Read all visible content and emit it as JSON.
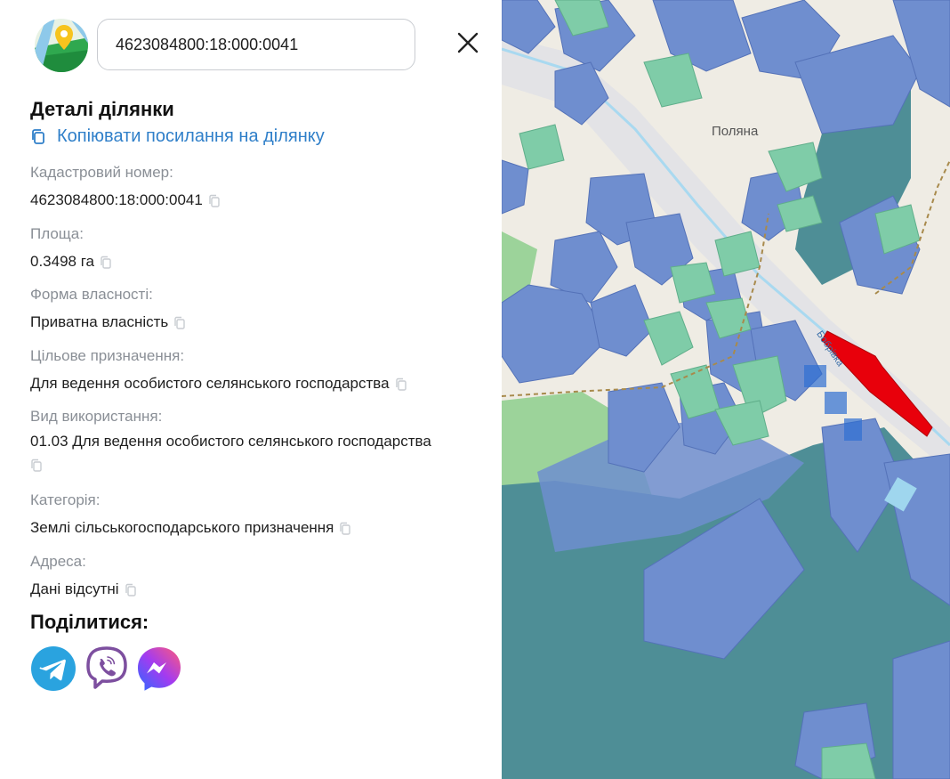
{
  "search": {
    "value": "4623084800:18:000:0041",
    "icon": "close-icon"
  },
  "panel": {
    "title": "Деталі ділянки",
    "copy_link_label": "Копіювати посилання на ділянку",
    "fields": [
      {
        "label": "Кадастровий номер:",
        "value": "4623084800:18:000:0041"
      },
      {
        "label": "Площа:",
        "value": "0.3498 га"
      },
      {
        "label": "Форма власності:",
        "value": "Приватна власність"
      },
      {
        "label": "Цільове призначення:",
        "value": "Для ведення особистого селянського господарства"
      },
      {
        "label": "Вид використання:",
        "value": "01.03 Для ведення особистого селянського господарства"
      },
      {
        "label": "Категорія:",
        "value": "Землі сільськогосподарського призначення"
      },
      {
        "label": "Адреса:",
        "value": "Дані відсутні"
      }
    ],
    "share_title": "Поділитися:",
    "share_buttons": [
      "telegram-icon",
      "viber-icon",
      "messenger-icon"
    ]
  },
  "map": {
    "place_label": "Поляна",
    "street_label": "Бобрівка"
  },
  "colors": {
    "accent": "#2f7fc9",
    "parcel_highlight": "#e8000b",
    "telegram": "#2aa3df",
    "viber": "#7d4f9f",
    "messenger": "#6a4cf0"
  }
}
